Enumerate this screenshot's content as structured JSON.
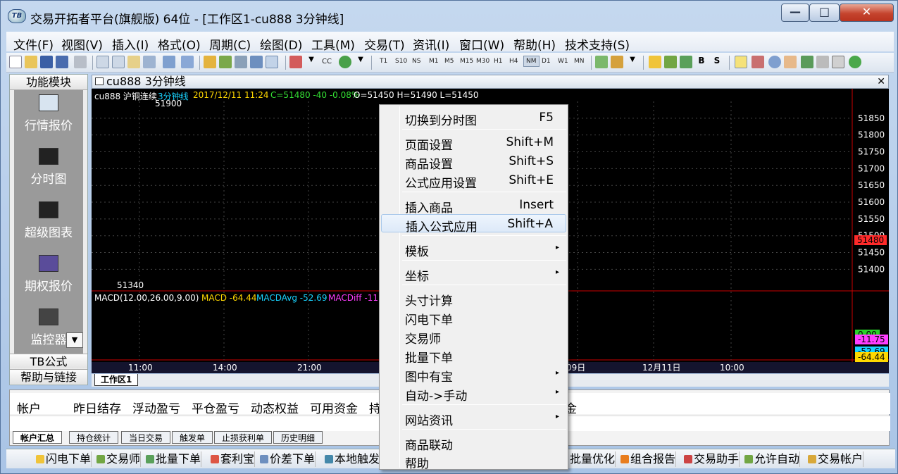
{
  "window": {
    "app_icon": "TB",
    "title": "交易开拓者平台(旗舰版) 64位 - [工作区1-cu888 3分钟线]",
    "min_icon": "minimize-icon",
    "max_icon": "maximize-icon",
    "close_icon": "close-icon",
    "min_glyph": "—",
    "max_glyph": "□",
    "close_glyph": "✕"
  },
  "menubar": [
    "文件(F)",
    "视图(V)",
    "插入(I)",
    "格式(O)",
    "周期(C)",
    "绘图(D)",
    "工具(M)",
    "交易(T)",
    "资讯(I)",
    "窗口(W)",
    "帮助(H)",
    "技术支持(S)"
  ],
  "toolbar": {
    "cc_label": "CC",
    "periods": [
      "T1",
      "S10",
      "NS",
      "M1",
      "M5",
      "M15",
      "M30",
      "H1",
      "H4",
      "NM",
      "D1",
      "W1",
      "MN"
    ],
    "selected_period": "NM"
  },
  "left_panel": {
    "header": "功能模块",
    "items": [
      "行情报价",
      "分时图",
      "超级图表",
      "期权报价",
      "监控器"
    ],
    "footer_1": "TB公式",
    "footer_2": "帮助与链接",
    "dropdown_glyph": "▼"
  },
  "chart_window": {
    "title": "cu888 3分钟线",
    "close_glyph": "✕"
  },
  "chart_info": {
    "symbol": "cu888 沪铜连续",
    "period": "3分钟线",
    "datetime": "2017/12/11 11:24",
    "close": "C=51480 -40 -0.08%",
    "ohlc": "O=51450 H=51490 L=51450",
    "high_label": "51900",
    "low_label": "51340",
    "last_price": "51480"
  },
  "macd_info": {
    "name": "MACD(12.00,26.00,9.00)",
    "macd": "MACD -64.44",
    "avg": "MACDAvg -52.69",
    "diff": "MACDiff -11"
  },
  "macd_axis": [
    "0.00",
    "-11.75",
    "-52.69",
    "-64.44"
  ],
  "chart_data": {
    "type": "candlestick",
    "y_ticks": [
      51850,
      51800,
      51750,
      51700,
      51650,
      51600,
      51550,
      51500,
      51450,
      51400
    ],
    "x_ticks": [
      "11:00",
      "14:00",
      "21:00",
      "09日",
      "12月11日",
      "10:00"
    ],
    "ylim": [
      51340,
      51900
    ]
  },
  "sheet_tab": "工作区1",
  "account": {
    "columns": [
      "帐户",
      "昨日结存",
      "浮动盈亏",
      "平仓盈亏",
      "动态权益",
      "可用资金",
      "持",
      "金"
    ],
    "tabs": [
      "帐户汇总",
      "持仓统计",
      "当日交易",
      "触发单",
      "止损获利单",
      "历史明细"
    ]
  },
  "bottom_bar": [
    "闪电下单",
    "交易师",
    "批量下单",
    "套利宝",
    "价差下单",
    "本地触发",
    "批量优化",
    "组合报告",
    "交易助手",
    "允许自动",
    "交易帐户"
  ],
  "context_menu": {
    "items": [
      {
        "label": "切换到分时图",
        "shortcut": "F5"
      },
      {
        "label": "页面设置",
        "shortcut": "Shift+M"
      },
      {
        "label": "商品设置",
        "shortcut": "Shift+S"
      },
      {
        "label": "公式应用设置",
        "shortcut": "Shift+E"
      },
      {
        "label": "插入商品",
        "shortcut": "Insert"
      },
      {
        "label": "插入公式应用",
        "shortcut": "Shift+A"
      },
      {
        "label": "模板",
        "shortcut": ""
      },
      {
        "label": "坐标",
        "shortcut": ""
      },
      {
        "label": "头寸计算",
        "shortcut": ""
      },
      {
        "label": "闪电下单",
        "shortcut": ""
      },
      {
        "label": "交易师",
        "shortcut": ""
      },
      {
        "label": "批量下单",
        "shortcut": ""
      },
      {
        "label": "图中有宝",
        "shortcut": ""
      },
      {
        "label": "自动->手动",
        "shortcut": ""
      },
      {
        "label": "网站资讯",
        "shortcut": ""
      },
      {
        "label": "商品联动",
        "shortcut": ""
      },
      {
        "label": "帮助",
        "shortcut": ""
      }
    ],
    "submenu_glyph": "▸"
  }
}
